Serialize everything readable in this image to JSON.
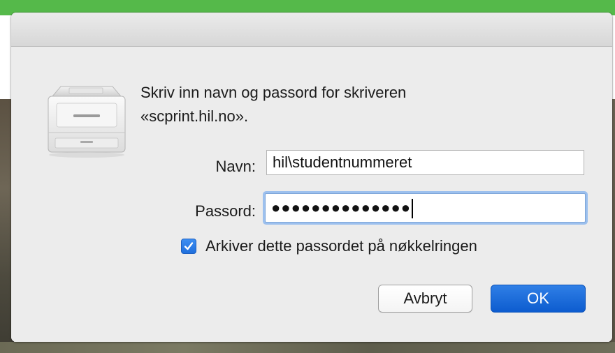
{
  "dialog": {
    "message_line1": "Skriv inn navn og passord for skriveren",
    "message_line2": "«scprint.hil.no».",
    "name_label": "Navn:",
    "name_value": "hil\\studentnummeret",
    "password_label": "Passord:",
    "password_value": "●●●●●●●●●●●●●●",
    "keychain_checkbox_label": "Arkiver dette passordet på nøkkelringen",
    "keychain_checked": true,
    "cancel_label": "Avbryt",
    "ok_label": "OK",
    "icon": "printer-icon"
  },
  "colors": {
    "accent": "#1f6fdd",
    "background_top": "#55b94a",
    "dialog_bg": "#ececec"
  }
}
